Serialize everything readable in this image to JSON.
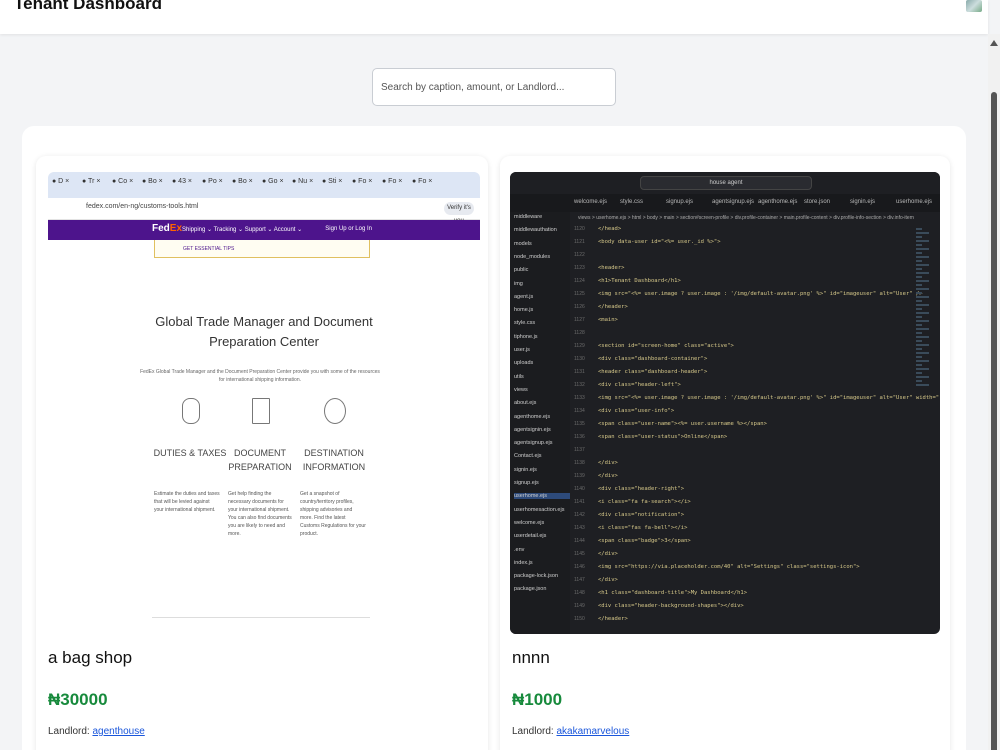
{
  "header": {
    "title": "Tenant Dashboard",
    "avatar_icon": "user-avatar-icon"
  },
  "search": {
    "placeholder": "Search by caption, amount, or Landlord..."
  },
  "listings": [
    {
      "caption": "a bag shop",
      "amount": "₦30000",
      "landlord_label": "Landlord: ",
      "landlord": "agenthouse",
      "screenshot": {
        "tabs": [
          "D",
          "Tr",
          "Co",
          "Bo",
          "43",
          "Po",
          "Bo",
          "Go",
          "Nu",
          "Sti",
          "Fo",
          "Fo",
          "Fo"
        ],
        "url": "fedex.com/en-ng/customs-tools.html",
        "profile_button": "Verify it's you",
        "logo_fed": "Fed",
        "logo_ex": "Ex",
        "menu": "Shipping ⌄   Tracking ⌄   Support ⌄   Account ⌄",
        "sign_in": "Sign Up or Log In",
        "banner": "GET ESSENTIAL TIPS",
        "heading": "Global Trade Manager and Document Preparation Center",
        "subtitle": "FedEx Global Trade Manager and the Document Preparation Center provide you with some of the resources for international shipping information.",
        "columns": [
          {
            "title": "DUTIES & TAXES",
            "text": "Estimate the duties and taxes that will be levied against your international shipment."
          },
          {
            "title": "DOCUMENT PREPARATION",
            "text": "Get help finding the necessary documents for your international shipment. You can also find documents you are likely to need and more."
          },
          {
            "title": "DESTINATION INFORMATION",
            "text": "Get a snapshot of country/territory profiles, shipping advisories and more. Find the latest Customs Regulations for your product."
          }
        ]
      }
    },
    {
      "caption": "nnnn",
      "amount": "₦1000",
      "landlord_label": "Landlord: ",
      "landlord": "akakamarvelous",
      "screenshot": {
        "search": "house agent",
        "tabs": [
          "welcome.ejs",
          "style.css",
          "signup.ejs",
          "agentsignup.ejs",
          "agenthome.ejs",
          "store.json",
          "signin.ejs",
          "userhome.ejs"
        ],
        "breadcrumb": "views > userhome.ejs > html > body > main > section#screen-profile > div.profile-container > main.profile-content > div.profile-info-section > div.info-item",
        "files": [
          "middleware",
          "middlewauthation",
          "models",
          "node_modules",
          "public",
          "img",
          "agent.js",
          "home.js",
          "style.css",
          "tiphone.js",
          "user.js",
          "uploads",
          "utils",
          "views",
          "about.ejs",
          "agenthome.ejs",
          "agentsignin.ejs",
          "agentsignup.ejs",
          "Contact.ejs",
          "signin.ejs",
          "signup.ejs",
          "userhome.ejs",
          "userhomesaction.ejs",
          "welcome.ejs",
          "userdetail.ejs",
          ".env",
          "index.js",
          "package-lock.json",
          "package.json"
        ],
        "line_start": 1120,
        "code": [
          "</head>",
          "<body data-user id=\"<%= user._id %>\">",
          "",
          "  <header>",
          "    <h1>Tenant Dashboard</h1>",
          "    <img src=\"<%= user.image ? user.image : '/img/default-avatar.png' %>\" id=\"imageuser\" alt=\"User\" />",
          "  </header>",
          "  <main>",
          "",
          "    <section id=\"screen-home\" class=\"active\">",
          "      <div class=\"dashboard-container\">",
          "        <header class=\"dashboard-header\">",
          "          <div class=\"header-left\">",
          "            <img src=\"<%= user.image ? user.image : '/img/default-avatar.png' %>\" id=\"imageuser\" alt=\"User\" width=\"",
          "            <div class=\"user-info\">",
          "              <span class=\"user-name\"><%= user.username %></span>",
          "              <span class=\"user-status\">Online</span>",
          "",
          "            </div>",
          "          </div>",
          "          <div class=\"header-right\">",
          "            <i class=\"fa fa-search\"></i>",
          "            <div class=\"notification\">",
          "              <i class=\"fas fa-bell\"></i>",
          "              <span class=\"badge\">3</span>",
          "            </div>",
          "            <img src=\"https://via.placeholder.com/40\" alt=\"Settings\" class=\"settings-icon\">",
          "          </div>",
          "          <h1 class=\"dashboard-title\">My Dashboard</h1>",
          "          <div class=\"header-background-shapes\"></div>",
          "        </header>"
        ]
      }
    }
  ]
}
